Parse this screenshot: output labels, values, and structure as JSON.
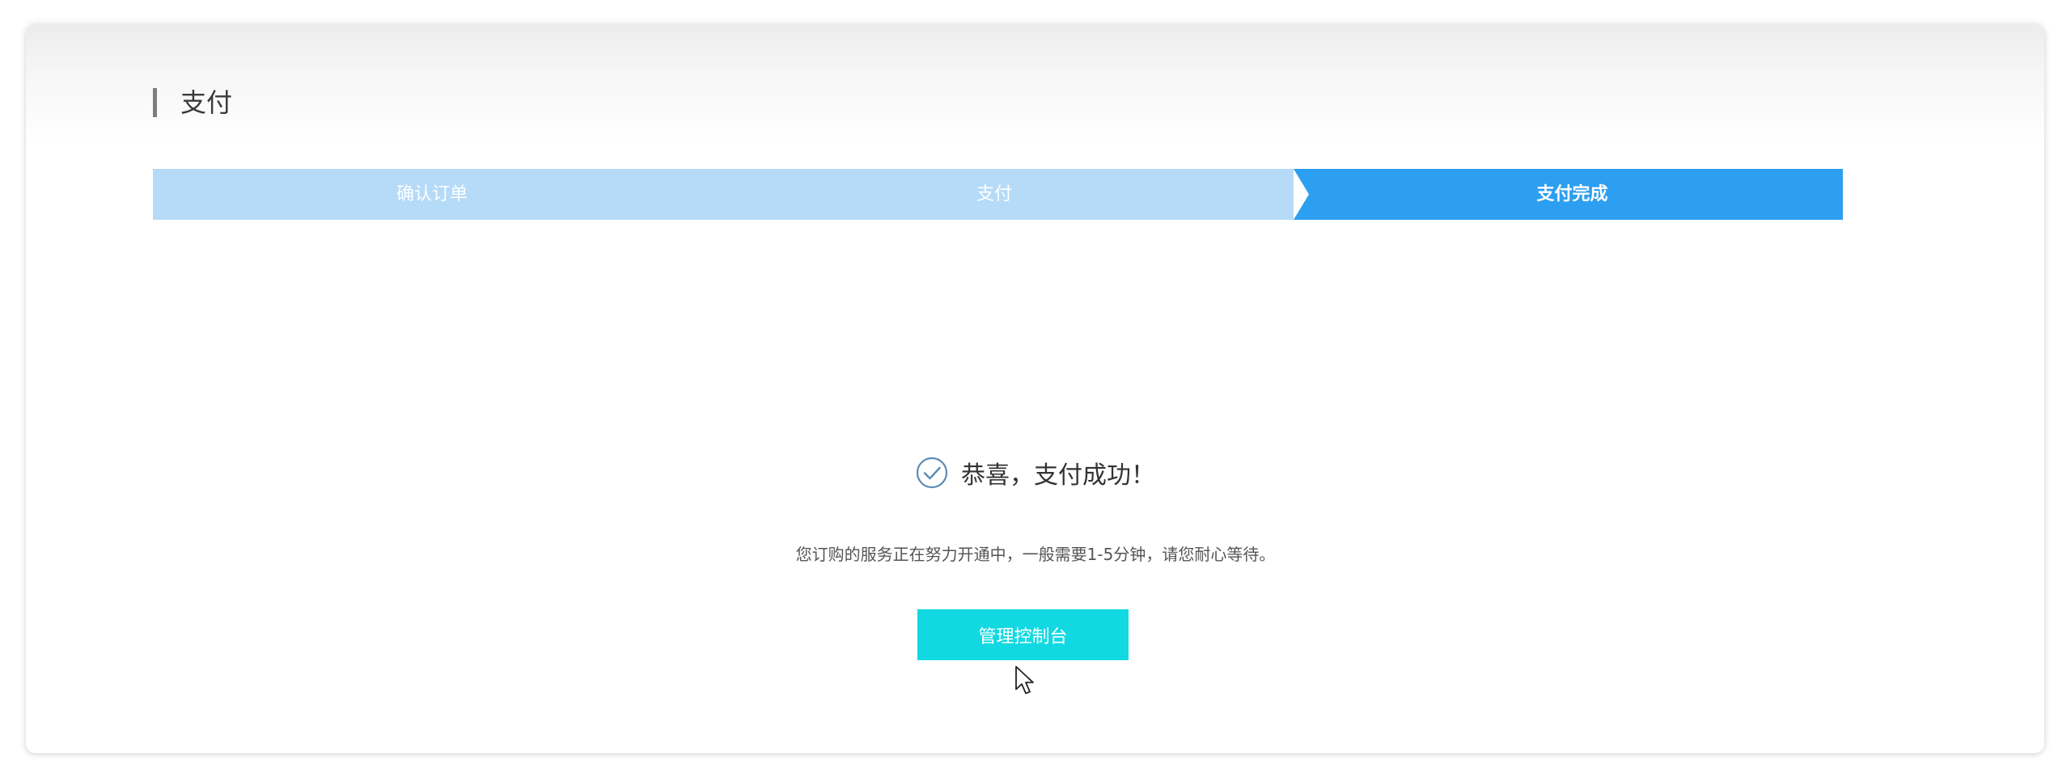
{
  "section": {
    "title": "支付"
  },
  "steps": [
    {
      "label": "确认订单",
      "state": "done"
    },
    {
      "label": "支付",
      "state": "done"
    },
    {
      "label": "支付完成",
      "state": "active"
    }
  ],
  "result": {
    "title": "恭喜，支付成功！",
    "description": "您订购的服务正在努力开通中，一般需要1-5分钟，请您耐心等待。",
    "button_label": "管理控制台"
  },
  "icons": {
    "success": "check-circle-icon",
    "pointer": "mouse-cursor-icon"
  },
  "colors": {
    "step_done": "#b5dbf8",
    "step_active": "#2d9ff0",
    "button": "#12d9e1",
    "title_bar": "#7d7d7d",
    "check": "#5b8bb5"
  }
}
